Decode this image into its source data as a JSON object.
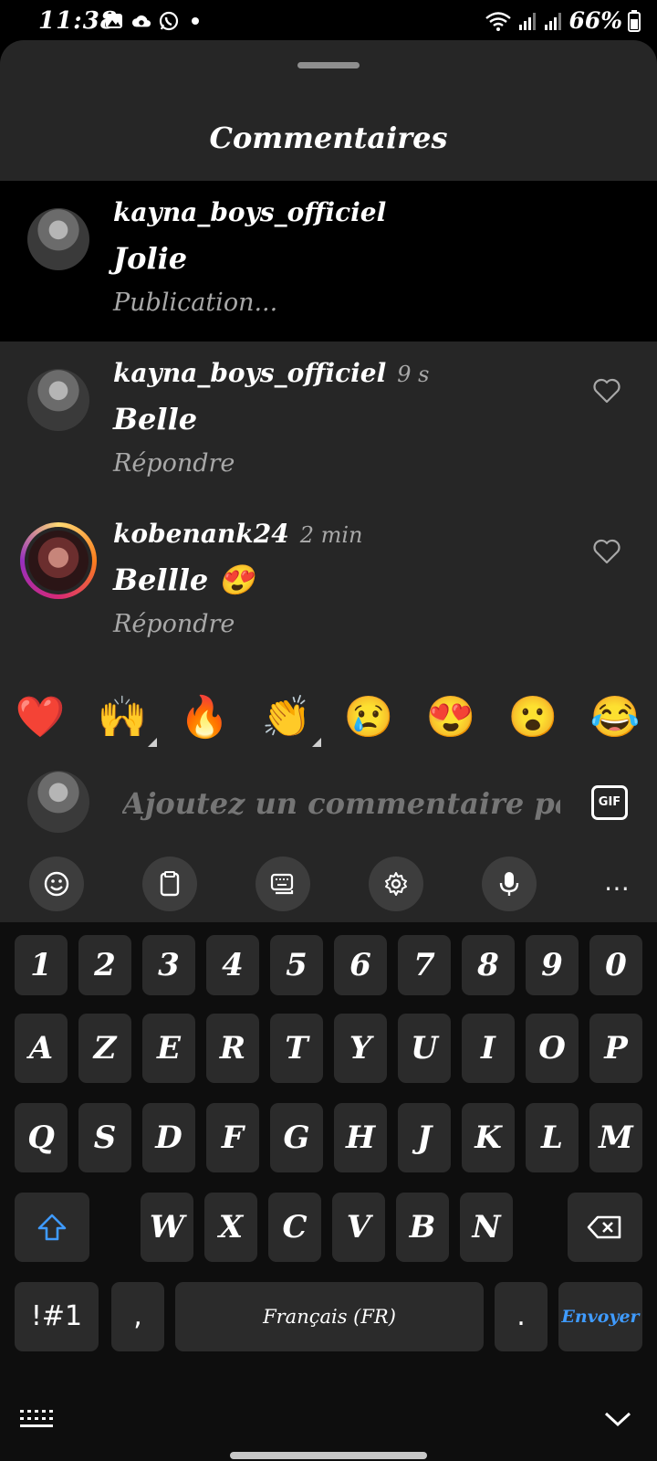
{
  "status_bar": {
    "time": "11:38",
    "battery": "66%",
    "icons": [
      "gallery-icon",
      "cloud-sync-icon",
      "whatsapp-icon",
      "dot-icon",
      "wifi-icon",
      "signal-icon",
      "signal-icon",
      "battery-icon"
    ]
  },
  "sheet": {
    "title": "Commentaires"
  },
  "comments": [
    {
      "user": "kayna_boys_officiel",
      "time": "",
      "text": "Jolie",
      "sub": "Publication..."
    },
    {
      "user": "kayna_boys_officiel",
      "time": "9 s",
      "text": "Belle",
      "sub": "Répondre"
    },
    {
      "user": "kobenank24",
      "time": "2 min",
      "text": "Bellle 😍",
      "sub": "Répondre"
    }
  ],
  "reactions": [
    "❤️",
    "🙌",
    "🔥",
    "👏",
    "😢",
    "😍",
    "😮",
    "😂"
  ],
  "composer": {
    "placeholder": "Ajoutez un commentaire pour n",
    "gif_label": "GIF"
  },
  "keyboard": {
    "toolbar": [
      "emoji-icon",
      "clipboard-icon",
      "keyboard-mode-icon",
      "settings-icon",
      "microphone-icon",
      "more-icon"
    ],
    "more_label": "⋯",
    "row_numbers": [
      "1",
      "2",
      "3",
      "4",
      "5",
      "6",
      "7",
      "8",
      "9",
      "0"
    ],
    "row1": [
      "A",
      "Z",
      "E",
      "R",
      "T",
      "Y",
      "U",
      "I",
      "O",
      "P"
    ],
    "row2": [
      "Q",
      "S",
      "D",
      "F",
      "G",
      "H",
      "J",
      "K",
      "L",
      "M"
    ],
    "row3": [
      "W",
      "X",
      "C",
      "V",
      "B",
      "N"
    ],
    "symbols_label": "!#1",
    "comma_label": ",",
    "space_label": "Français (FR)",
    "period_label": ".",
    "send_label": "Envoyer"
  },
  "colors": {
    "sheet_bg": "#262626",
    "keyboard_bg": "#0e0e0e",
    "key_bg": "#2b2b2b",
    "send_color": "#3f9bff",
    "secondary_text": "#a8a8a8"
  }
}
